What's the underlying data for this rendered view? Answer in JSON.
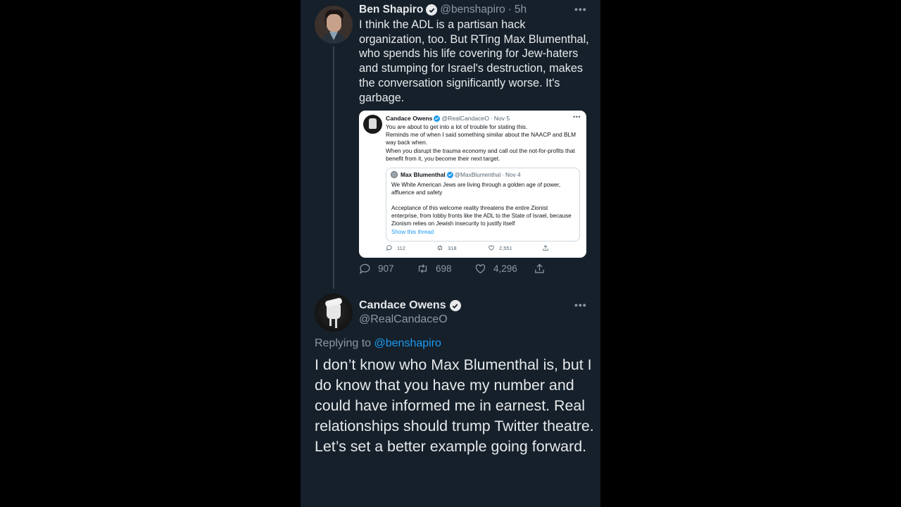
{
  "colors": {
    "background": "#15202b",
    "text_primary": "#e7e9ea",
    "text_secondary": "#8b98a5",
    "link": "#1d9bf0"
  },
  "tweet_main": {
    "author_name": "Ben Shapiro",
    "handle": "@benshapiro",
    "separator": "·",
    "time": "5h",
    "more_icon": "more-horizontal-icon",
    "text": "I think the ADL is a partisan hack organization, too. But RTing Max Blumenthal, who spends his life covering for Jew-haters and stumping for Israel's destruction, makes the conversation significantly worse. It's garbage.",
    "actions": {
      "replies": "907",
      "retweets": "698",
      "likes": "4,296"
    }
  },
  "quoted_screenshot": {
    "author_name": "Candace Owens",
    "handle": "@RealCandaceO",
    "separator": "·",
    "time": "Nov 5",
    "text": "You are about to get into a lot of trouble for stating this. Reminds me of when I said something similar about the NAACP and BLM way back when.\nWhen you disrupt the trauma economy and call out the not-for-profits that benefit from it, you become their next target.",
    "text_lines": [
      "You are about to get into a lot of trouble for stating this.",
      "Reminds me of when I said something similar about the NAACP and BLM way back when.",
      "When you disrupt the trauma economy and call out the not-for-profits that benefit from it, you become their next target."
    ],
    "inner_quote": {
      "author_name": "Max Blumenthal",
      "handle": "@MaxBlumenthal",
      "separator": "·",
      "time": "Nov 4",
      "text": "We White American Jews are living through a golden age of power, affluence and safety\n\nAcceptance of this welcome reality threatens the entire Zionist enterprise, from lobby fronts like the ADL to the State of Israel, because Zionism relies on Jewish insecurity to justify itself",
      "show_thread": "Show this thread"
    },
    "actions": {
      "replies": "112",
      "retweets": "318",
      "likes": "2,551"
    }
  },
  "tweet_reply": {
    "author_name": "Candace Owens",
    "handle": "@RealCandaceO",
    "replying_to_label": "Replying to",
    "replying_to_handle": "@benshapiro",
    "text": "I don’t know who Max Blumenthal is, but I do know that you have my number and could have informed me in earnest. Real relationships should trump Twitter theatre.\nLet’s set a better example going forward."
  }
}
